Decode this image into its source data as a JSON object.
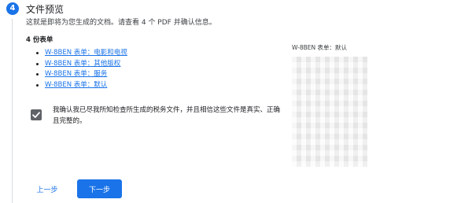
{
  "step": {
    "number": "4",
    "title": "文件预览",
    "description": "这就是即将为您生成的文档。请查看 4 个 PDF 并确认信息。"
  },
  "forms": {
    "count_label": "4 份表单",
    "items": [
      {
        "label": "W-8BEN 表单：电影和电视"
      },
      {
        "label": "W-8BEN 表单：其他版权"
      },
      {
        "label": "W-8BEN 表单：服务"
      },
      {
        "label": "W-8BEN 表单：默认"
      }
    ]
  },
  "confirm": {
    "checked": true,
    "text": "我确认我已尽我所知检查所生成的税务文件，并且相信这些文件是真实、正确且完整的。"
  },
  "preview": {
    "label": "W-8BEN 表单：默认"
  },
  "buttons": {
    "prev": "上一步",
    "next": "下一步"
  },
  "colors": {
    "accent": "#1a73e8",
    "checkbox": "#5f6368"
  }
}
